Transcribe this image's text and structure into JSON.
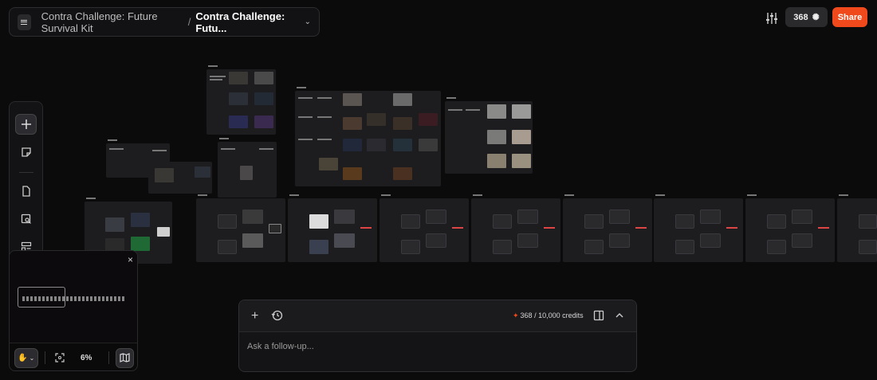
{
  "breadcrumb": {
    "project": "Contra Challenge: Future Survival Kit",
    "separator": "/",
    "current": "Contra Challenge: Futu..."
  },
  "topbar": {
    "credits_badge": "368",
    "share_label": "Share",
    "icons": [
      "menu-icon",
      "chevron-down-icon",
      "sliders-icon",
      "gear-icon"
    ]
  },
  "toolbar": {
    "tools": [
      "plus-icon",
      "sticky-note-icon",
      "file-icon",
      "image-search-icon",
      "layout-icon",
      "help-icon"
    ]
  },
  "minimap": {
    "close": "×",
    "zoom": "6%",
    "tools": [
      "hand-icon",
      "chevron-down-icon",
      "fit-screen-icon",
      "map-icon"
    ]
  },
  "chat": {
    "credits": "368 / 10,000 credits",
    "placeholder": "Ask a follow-up...",
    "icons": [
      "plus-icon",
      "history-icon",
      "panel-icon",
      "chevron-up-icon"
    ]
  },
  "colors": {
    "accent": "#f04a1c",
    "background": "#0b0b0c",
    "panel": "#141416"
  }
}
